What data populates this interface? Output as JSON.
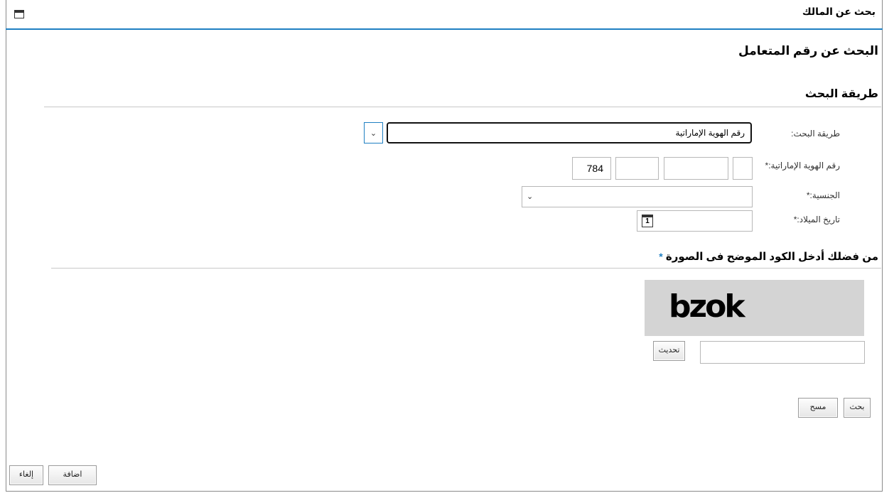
{
  "window": {
    "title": "بحث عن المالك",
    "icon": "window-icon"
  },
  "page": {
    "heading": "البحث عن رقم المتعامل"
  },
  "search_method_section": {
    "heading": "طريقة البحث",
    "fields": {
      "search_method": {
        "label": "طريقة البحث:",
        "value": "رقم الهوية الإماراتية"
      },
      "emirates_id": {
        "label": "رقم الهوية الإماراتية:*",
        "segments": [
          "784",
          "",
          "",
          ""
        ]
      },
      "nationality": {
        "label": "الجنسية:*",
        "value": ""
      },
      "date_of_birth": {
        "label": "تاريخ الميلاد:*",
        "value": "",
        "calendar_day": "1"
      }
    }
  },
  "captcha_section": {
    "heading": "من فضلك أدخل الكود الموضح فى الصورة",
    "required_mark": "*",
    "captcha_text": "bzok",
    "input_value": "",
    "refresh_label": "تحديث"
  },
  "actions": {
    "search_label": "بحث",
    "clear_label": "مسح",
    "add_label": "اضافة",
    "cancel_label": "إلغاء"
  },
  "colors": {
    "accent": "#1f7fc2",
    "border": "#b7b7b7"
  }
}
